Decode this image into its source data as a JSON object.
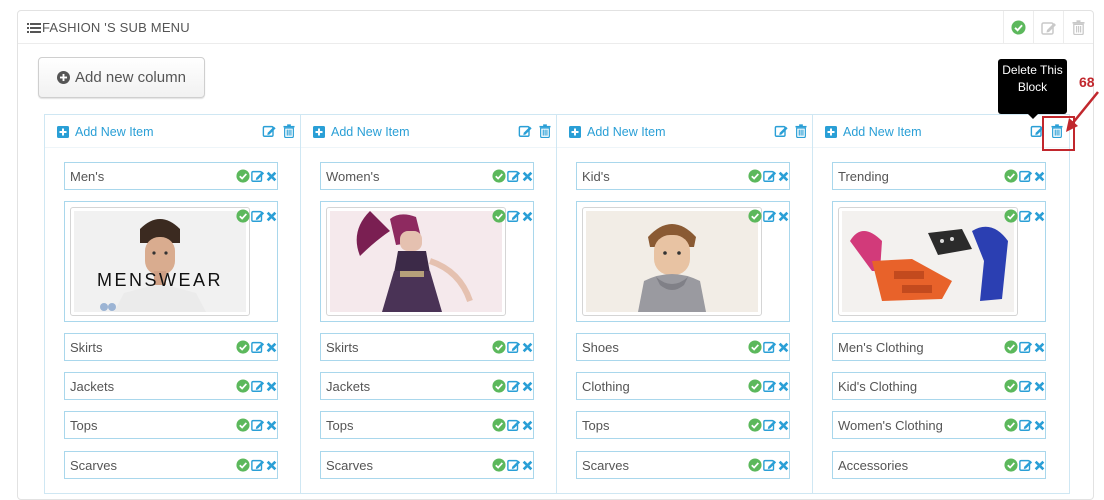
{
  "panel": {
    "title": "FASHION 'S SUB MENU",
    "header_actions": [
      "check-icon",
      "edit-icon",
      "trash-icon"
    ]
  },
  "add_column_button": {
    "label": "Add new column"
  },
  "columns": [
    {
      "add_item_label": "Add New Item",
      "items": [
        "Men's",
        "Skirts",
        "Jackets",
        "Tops",
        "Scarves"
      ],
      "image_text": "MENSWEAR"
    },
    {
      "add_item_label": "Add New Item",
      "items": [
        "Women's",
        "Skirts",
        "Jackets",
        "Tops",
        "Scarves"
      ]
    },
    {
      "add_item_label": "Add New Item",
      "items": [
        "Kid's",
        "Shoes",
        "Clothing",
        "Tops",
        "Scarves"
      ]
    },
    {
      "add_item_label": "Add New Item",
      "items": [
        "Trending",
        "Men's Clothing",
        "Kid's Clothing",
        "Women's Clothing",
        "Accessories"
      ]
    }
  ],
  "tooltip": {
    "text": "Delete This Block"
  },
  "callout": {
    "number": "68"
  },
  "colors": {
    "accent": "#2a9fd6",
    "success": "#5cb85c",
    "callout": "#c1272d",
    "item_border": "#a9d7ec"
  }
}
